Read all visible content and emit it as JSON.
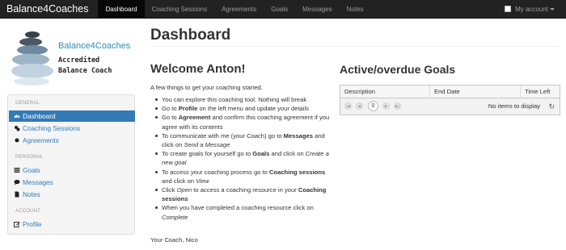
{
  "navbar": {
    "brand": "Balance4Coaches",
    "items": [
      {
        "label": "Dashboard"
      },
      {
        "label": "Coaching Sessions"
      },
      {
        "label": "Agreements"
      },
      {
        "label": "Goals"
      },
      {
        "label": "Messages"
      },
      {
        "label": "Notes"
      }
    ],
    "account_label": "My account"
  },
  "logo": {
    "name": "Balance4Coaches",
    "tagline": "Accredited\nBalance Coach"
  },
  "sidebar": {
    "sections": [
      {
        "heading": "GENERAL",
        "items": [
          {
            "label": "Dashboard",
            "icon": "dashboard-icon"
          },
          {
            "label": "Coaching Sessions",
            "icon": "sessions-icon"
          },
          {
            "label": "Agreements",
            "icon": "agreement-icon"
          }
        ]
      },
      {
        "heading": "PERSONAL",
        "items": [
          {
            "label": "Goals",
            "icon": "goals-icon"
          },
          {
            "label": "Messages",
            "icon": "messages-icon"
          },
          {
            "label": "Notes",
            "icon": "notes-icon"
          }
        ]
      },
      {
        "heading": "ACCOUNT",
        "items": [
          {
            "label": "Profile",
            "icon": "edit-icon"
          }
        ]
      }
    ]
  },
  "main": {
    "title": "Dashboard",
    "welcome": "Welcome Anton!",
    "intro": "A few things to get your coaching started.",
    "signoff": "Your Coach, Nico",
    "instructions": {
      "i1": "You can explore this coaching tool. Nothing will break",
      "i2a": "Go to ",
      "i2b": "Profile",
      "i2c": " on the left menu and update your details",
      "i3a": "Go to ",
      "i3b": "Agreement",
      "i3c": " and confirm this coaching agreement if you agree with its contents",
      "i4a": "To communicate with me (your Coach) go to ",
      "i4b": "Messages",
      "i4c": " and click on ",
      "i4d": "Send a Message",
      "i5a": "To create goals for yourself go to ",
      "i5b": "Goals",
      "i5c": " and click on ",
      "i5d": "Create a new goal",
      "i6a": "To access your coaching process go to ",
      "i6b": "Coaching sessions",
      "i6c": " and click on ",
      "i6d": "View",
      "i7a": "Click ",
      "i7b": "Open",
      "i7c": " to access a coaching resource in your ",
      "i7d": "Coaching sessions",
      "i8a": "When you have completed a coaching resource click on ",
      "i8b": "Complete"
    }
  },
  "goals": {
    "title": "Active/overdue Goals",
    "columns": [
      "Description",
      "End Date",
      "Time Left"
    ],
    "current_page": "0",
    "empty_text": "No items to display"
  },
  "colors": {
    "navbar_bg": "#222222",
    "accent": "#337ab7",
    "brand_text": "#2a8dbd"
  }
}
